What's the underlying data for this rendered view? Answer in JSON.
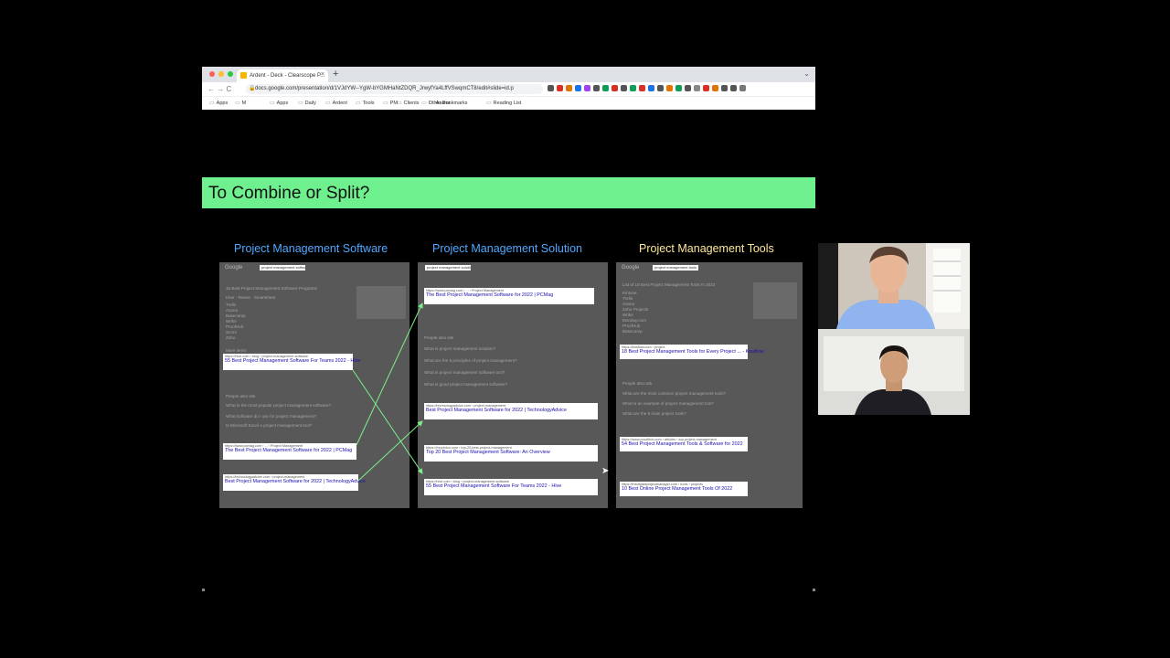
{
  "browser": {
    "tab_title": "Ardent - Deck - Clearscope P...",
    "tab_close": "×",
    "new_tab": "+",
    "tab_menu": "⌄",
    "nav_icons": "←  →  C",
    "url": "docs.google.com/presentation/d/1VJdYW--YgW-bYGMHaNtZDQR_JrwyfYa4LffVSwqmCT8/edit#slide=id.p",
    "bookmarks": [
      "Apps",
      "M",
      "",
      "",
      "Apps",
      "Daily",
      "Ardent",
      "Tools",
      "PM",
      "Clients",
      "Asana"
    ],
    "other_bookmarks": "Other Bookmarks",
    "reading_list": "Reading List",
    "ext_colors": [
      "#555",
      "#d93025",
      "#e37400",
      "#1a73e8",
      "#a142f4",
      "#555",
      "#0f9d58",
      "#d93025",
      "#555",
      "#0f9d58",
      "#d93025",
      "#1a73e8",
      "#555",
      "#e37400",
      "#0f9d58",
      "#555",
      "#888",
      "#d93025",
      "#e37400",
      "#555",
      "#555",
      "#777"
    ]
  },
  "slide": {
    "title": "To Combine or Split?",
    "header_color": "#6ef08f",
    "columns": [
      {
        "title": "Project Management Software",
        "color": "#4fa8ff"
      },
      {
        "title": "Project Management Solution",
        "color": "#4fa8ff"
      },
      {
        "title": "Project Management Tools",
        "color": "#ffe89a"
      }
    ]
  },
  "panels": {
    "p1": {
      "logo": "Google",
      "query": "project management software",
      "faint": [
        "15 Best Project Management Software Programs",
        "Hive · Teams · Smartsheet",
        "Trello",
        "Asana",
        "Basecamp",
        "Wrike",
        "ProofHub",
        "Scoro",
        "Zoho",
        "More items",
        "People also ask",
        "What is the most popular project management software?",
        "What software do I use for project management?",
        "Is Microsoft Excel a project management tool?"
      ],
      "cards": [
        {
          "url": "https://hive.com › blog › project-management-software",
          "title": "55 Best Project Management Software For Teams 2022 - Hive"
        },
        {
          "url": "https://www.pcmag.com › ... › Project Management",
          "title": "The Best Project Management Software for 2022 | PCMag"
        },
        {
          "url": "https://technologyadvice.com › project-management",
          "title": "Best Project Management Software for 2022 | TechnologyAdvice"
        }
      ]
    },
    "p2": {
      "logo": "Google",
      "query": "project management solution",
      "faint": [
        "People also ask",
        "What is project management solution?",
        "What are the 5 principles of project management?",
        "What is project management software tool?",
        "What is good project management software?"
      ],
      "cards": [
        {
          "url": "https://www.pcmag.com › ... › Project Management",
          "title": "The Best Project Management Software for 2022 | PCMag"
        },
        {
          "url": "https://technologyadvice.com › project-management",
          "title": "Best Project Management Software for 2022 | TechnologyAdvice"
        },
        {
          "url": "https://mopinion.com › top-20-best-project-management",
          "title": "Top 20 Best Project Management Software: An Overview"
        },
        {
          "url": "https://hive.com › blog › project-management-software",
          "title": "55 Best Project Management Software For Teams 2022 - Hive"
        }
      ]
    },
    "p3": {
      "logo": "Google",
      "query": "project management tools",
      "faint": [
        "List of 18 Best Project Management Tools In 2022",
        "Kintone",
        "Trello",
        "Asana",
        "Zoho Projects",
        "Wrike",
        "Monday.com",
        "ProofHub",
        "Basecamp",
        "People also ask",
        "What are the most common project management tools?",
        "What is an example of project management tool?",
        "What are the 5 main project tools?"
      ],
      "cards": [
        {
          "url": "https://kissflow.com › project",
          "title": "18 Best Project Management Tools for Every Project ... - Kissflow"
        },
        {
          "url": "https://www.proofhub.com › articles › top-project-management",
          "title": "54 Best Project Management Tools & Software for 2022"
        },
        {
          "url": "https://thedigitalprojectmanager.com › tools › projects",
          "title": "10 Best Online Project Management Tools Of 2022"
        }
      ]
    }
  }
}
